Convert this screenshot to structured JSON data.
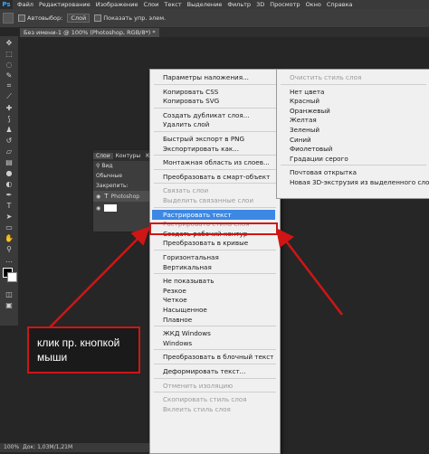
{
  "app": {
    "logo": "Ps"
  },
  "menubar": [
    "Файл",
    "Редактирование",
    "Изображение",
    "Слои",
    "Текст",
    "Выделение",
    "Фильтр",
    "3D",
    "Просмотр",
    "Окно",
    "Справка"
  ],
  "options": {
    "autoselect": "Автовыбор:",
    "layer_select": "Слой",
    "show_controls": "Показать упр. элем."
  },
  "doc_tab": "Без имени-1 @ 100% (Photoshop, RGB/8*) *",
  "layers_panel": {
    "tabs": [
      "Слои",
      "Контуры",
      "Ка"
    ],
    "search": "Вид",
    "blend": "Обычные",
    "lock": "Закрепить:",
    "layer_name": "Photoshop"
  },
  "context_menu": {
    "col1": [
      {
        "label": "Параметры наложения...",
        "disabled": false
      },
      {
        "sep": true
      },
      {
        "label": "Копировать CSS",
        "disabled": false
      },
      {
        "label": "Копировать SVG",
        "disabled": false
      },
      {
        "sep": true
      },
      {
        "label": "Создать дубликат слоя...",
        "disabled": false
      },
      {
        "label": "Удалить слой",
        "disabled": false
      },
      {
        "sep": true
      },
      {
        "label": "Быстрый экспорт в PNG",
        "disabled": false
      },
      {
        "label": "Экспортировать как...",
        "disabled": false
      },
      {
        "sep": true
      },
      {
        "label": "Монтажная область из слоев...",
        "disabled": false
      },
      {
        "sep": true
      },
      {
        "label": "Преобразовать в смарт-объект",
        "disabled": false
      },
      {
        "sep": true
      },
      {
        "label": "Связать слои",
        "disabled": true
      },
      {
        "label": "Выделить связанные слои",
        "disabled": true
      },
      {
        "sep": true
      },
      {
        "label": "Растрировать текст",
        "disabled": false,
        "highlighted": true
      },
      {
        "label": "Растрировать стиль слоя",
        "disabled": true
      },
      {
        "label": "Создать рабочий контур",
        "disabled": false
      },
      {
        "label": "Преобразовать в кривые",
        "disabled": false
      },
      {
        "sep": true
      },
      {
        "label": "Горизонтальная",
        "disabled": false
      },
      {
        "label": "Вертикальная",
        "disabled": false
      },
      {
        "sep": true
      },
      {
        "label": "Не показывать",
        "disabled": false
      },
      {
        "label": "Резкое",
        "disabled": false
      },
      {
        "label": "Четкое",
        "disabled": false
      },
      {
        "label": "Насыщенное",
        "disabled": false
      },
      {
        "label": "Плавное",
        "disabled": false
      },
      {
        "sep": true
      },
      {
        "label": "ЖКД Windows",
        "disabled": false
      },
      {
        "label": "Windows",
        "disabled": false
      },
      {
        "sep": true
      },
      {
        "label": "Преобразовать в блочный текст",
        "disabled": false
      },
      {
        "sep": true
      },
      {
        "label": "Деформировать текст...",
        "disabled": false
      },
      {
        "sep": true
      },
      {
        "label": "Отменить изоляцию",
        "disabled": true
      },
      {
        "sep": true
      },
      {
        "label": "Скопировать стиль слоя",
        "disabled": true
      },
      {
        "label": "Вклеить стиль слоя",
        "disabled": true
      }
    ],
    "col2": [
      {
        "label": "Очистить стиль слоя",
        "disabled": true
      },
      {
        "sep": true
      },
      {
        "label": "Нет цвета",
        "disabled": false
      },
      {
        "label": "Красный",
        "disabled": false
      },
      {
        "label": "Оранжевый",
        "disabled": false
      },
      {
        "label": "Желтая",
        "disabled": false
      },
      {
        "label": "Зеленый",
        "disabled": false
      },
      {
        "label": "Синий",
        "disabled": false
      },
      {
        "label": "Фиолетовый",
        "disabled": false
      },
      {
        "label": "Градации серого",
        "disabled": false
      },
      {
        "sep": true
      },
      {
        "label": "Почтовая открытка",
        "disabled": false
      },
      {
        "label": "Новая 3D-экструзия из выделенного слоя",
        "disabled": false
      }
    ]
  },
  "annotation": {
    "line1": "клик пр. кнопкой",
    "line2": "мыши"
  },
  "status": {
    "zoom": "100%",
    "doc": "Док: 1,03M/1,21M"
  },
  "colors": {
    "accent": "#3c88e3",
    "annotation": "#d01515"
  }
}
